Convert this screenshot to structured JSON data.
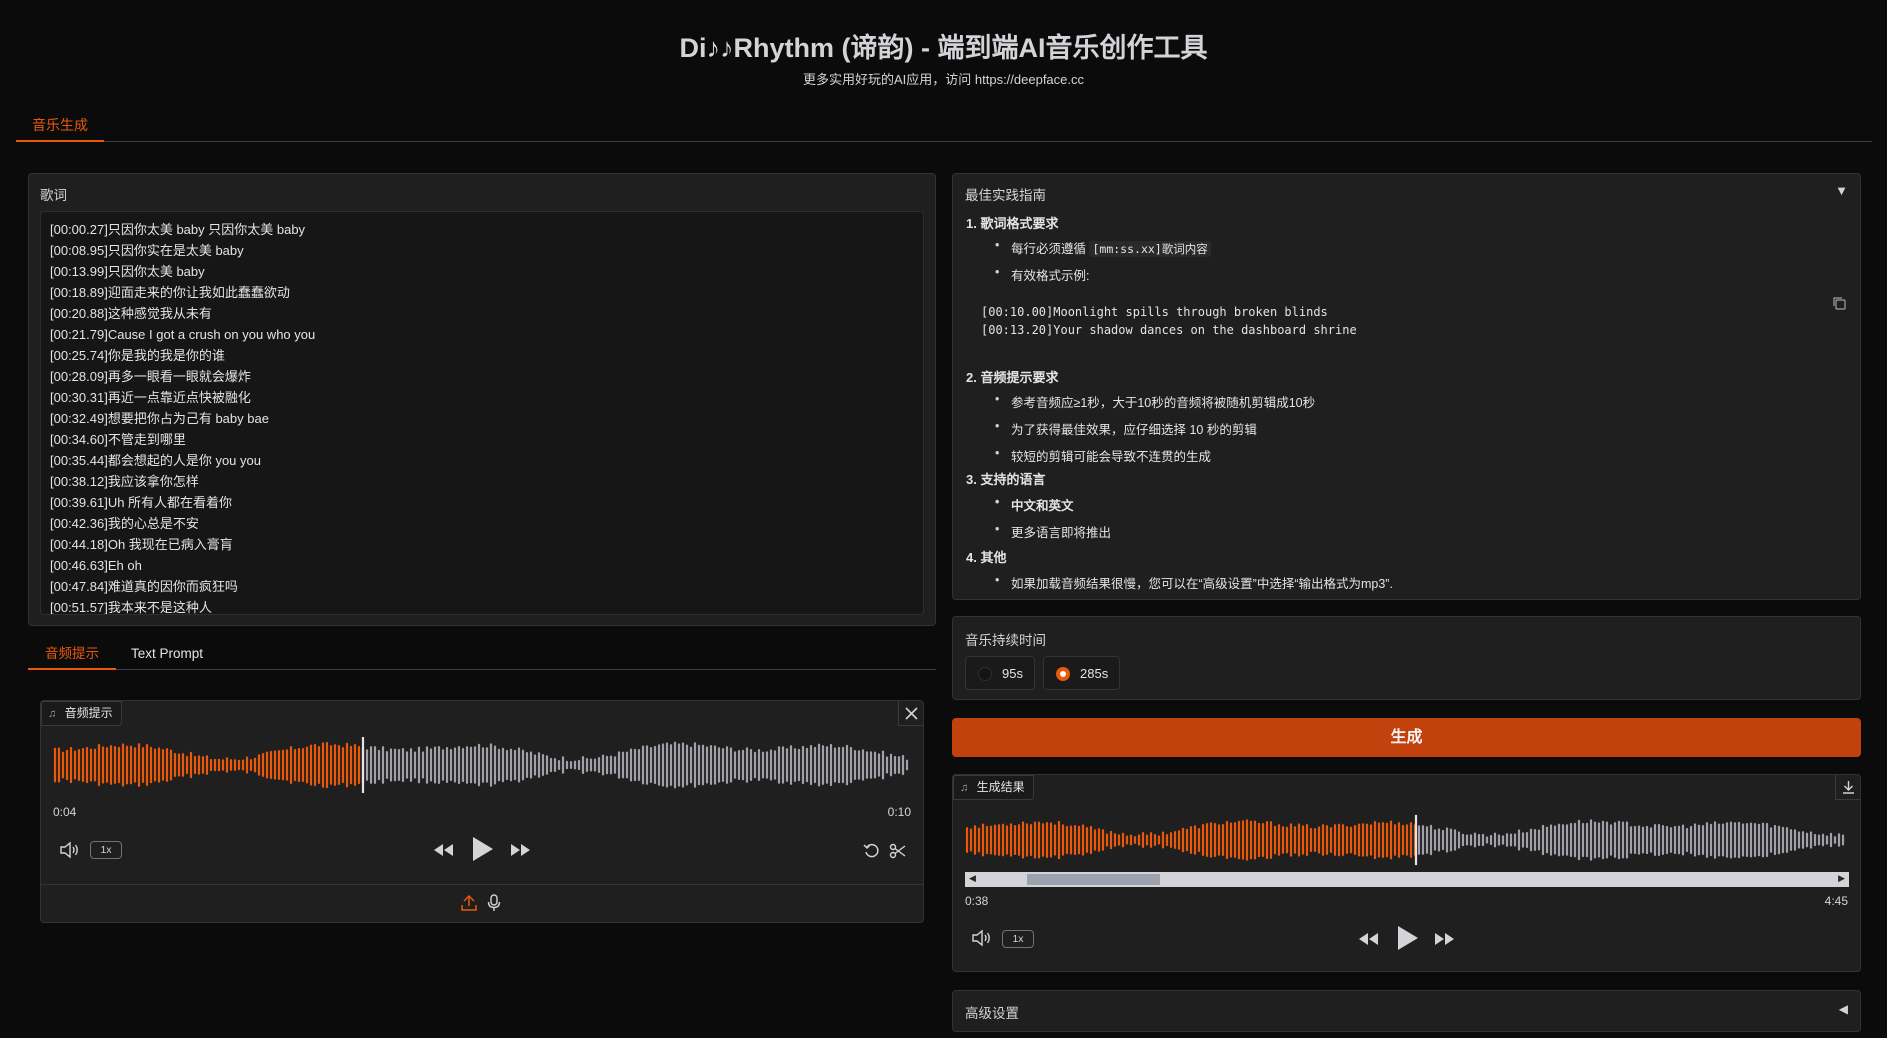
{
  "header": {
    "title": "Di♪♪Rhythm (谛韵) - 端到端AI音乐创作工具",
    "subtitle": "更多实用好玩的AI应用，访问 https://deepface.cc"
  },
  "main_tab": {
    "label": "音乐生成"
  },
  "lyrics": {
    "label": "歌词",
    "lines": [
      "[00:00.27]只因你太美 baby 只因你太美 baby",
      "[00:08.95]只因你实在是太美 baby",
      "[00:13.99]只因你太美 baby",
      "[00:18.89]迎面走来的你让我如此蠢蠢欲动",
      "[00:20.88]这种感觉我从未有",
      "[00:21.79]Cause I got a crush on you who you",
      "[00:25.74]你是我的我是你的谁",
      "[00:28.09]再多一眼看一眼就会爆炸",
      "[00:30.31]再近一点靠近点快被融化",
      "[00:32.49]想要把你占为己有 baby bae",
      "[00:34.60]不管走到哪里",
      "[00:35.44]都会想起的人是你 you you",
      "[00:38.12]我应该拿你怎样",
      "[00:39.61]Uh 所有人都在看着你",
      "[00:42.36]我的心总是不安",
      "[00:44.18]Oh 我现在已病入膏肓",
      "[00:46.63]Eh oh",
      "[00:47.84]难道真的因你而疯狂吗",
      "[00:51.57]我本来不是这种人"
    ]
  },
  "prompt_tabs": {
    "audio_tab": "音频提示",
    "text_tab": "Text Prompt"
  },
  "audio_prompt": {
    "label": "音频提示",
    "current_time": "0:04",
    "total_time": "0:10",
    "speed": "1x",
    "progress": 0.36
  },
  "guide": {
    "title": "最佳实践指南",
    "toggle_icon": "▼",
    "section1_title": "1. 歌词格式要求",
    "s1_item1_prefix": "每行必须遵循 ",
    "s1_item1_code": "[mm:ss.xx]歌词内容",
    "s1_item2": "有效格式示例:",
    "code_line1": "[00:10.00]Moonlight spills through broken blinds",
    "code_line2": "[00:13.20]Your shadow dances on the dashboard shrine",
    "section2_title": "2. 音频提示要求",
    "s2_item1": "参考音频应≥1秒，大于10秒的音频将被随机剪辑成10秒",
    "s2_item2": "为了获得最佳效果，应仔细选择 10 秒的剪辑",
    "s2_item3": "较短的剪辑可能会导致不连贯的生成",
    "section3_title": "3. 支持的语言",
    "s3_item1": "中文和英文",
    "s3_item2": "更多语言即将推出",
    "section4_title": "4. 其他",
    "s4_item1": "如果加载音频结果很慢，您可以在“高级设置”中选择“输出格式为mp3”."
  },
  "duration": {
    "label": "音乐持续时间",
    "options": [
      "95s",
      "285s"
    ],
    "selected": "285s"
  },
  "generate_button": "生成",
  "result": {
    "label": "生成结果",
    "current_time": "0:38",
    "total_time": "4:45",
    "speed": "1x",
    "progress": 0.51
  },
  "advanced": {
    "label": "高级设置",
    "toggle_icon": "◀"
  },
  "colors": {
    "accent": "#ea580c",
    "button": "#c2410c",
    "wave_played": "#ea580c",
    "wave_unplayed": "#a1a1aa"
  }
}
